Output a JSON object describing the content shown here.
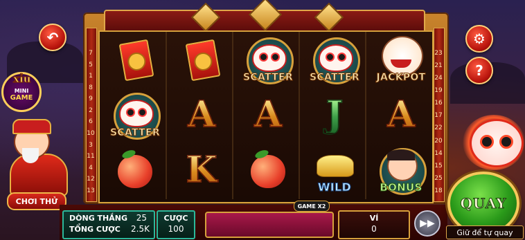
{
  "minigame": {
    "top": "xỉu",
    "mini": "MINI",
    "game": "GAME"
  },
  "buttons": {
    "back_icon": "undo-arrow-icon",
    "settings_icon": "gear-icon",
    "help_label": "?",
    "choi_thu": "CHƠI THỬ",
    "spin": "QUAY",
    "auto_spin": "Giữ để tự quay",
    "fast_forward_icon": "fast-forward-icon"
  },
  "paylines_left": [
    "7",
    "5",
    "1",
    "8",
    "9",
    "2",
    "6",
    "10",
    "3",
    "11",
    "4",
    "12",
    "13"
  ],
  "paylines_right": [
    "23",
    "21",
    "24",
    "19",
    "16",
    "17",
    "22",
    "20",
    "14",
    "15",
    "25",
    "18"
  ],
  "reels": [
    [
      {
        "symbol": "red-envelope",
        "label": ""
      },
      {
        "symbol": "lion-dance",
        "label": "SCATTER"
      },
      {
        "symbol": "peach",
        "label": ""
      }
    ],
    [
      {
        "symbol": "red-envelope",
        "label": ""
      },
      {
        "symbol": "A",
        "label": "A"
      },
      {
        "symbol": "K",
        "label": "K"
      }
    ],
    [
      {
        "symbol": "lion-dance",
        "label": "SCATTER"
      },
      {
        "symbol": "A",
        "label": "A"
      },
      {
        "symbol": "peach",
        "label": ""
      }
    ],
    [
      {
        "symbol": "lion-dance",
        "label": "SCATTER"
      },
      {
        "symbol": "J",
        "label": "J"
      },
      {
        "symbol": "gold-ingot",
        "label": "WILD"
      }
    ],
    [
      {
        "symbol": "god-of-wealth",
        "label": "JACKPOT"
      },
      {
        "symbol": "A",
        "label": "A"
      },
      {
        "symbol": "baby",
        "label": "BONUS"
      }
    ]
  ],
  "stats": {
    "lines_label": "DÒNG THẮNG",
    "lines_value": "25",
    "total_bet_label": "TỔNG CƯỢC",
    "total_bet_value": "2.5K",
    "bet_label": "CƯỢC",
    "bet_value": "100",
    "game_multiplier": "GAME X2",
    "wallet_label": "VÍ",
    "wallet_value": "0"
  },
  "colors": {
    "accent_gold": "#d7a13c",
    "spin_green": "#2a9a1a",
    "frame_red": "#8a1a14"
  }
}
